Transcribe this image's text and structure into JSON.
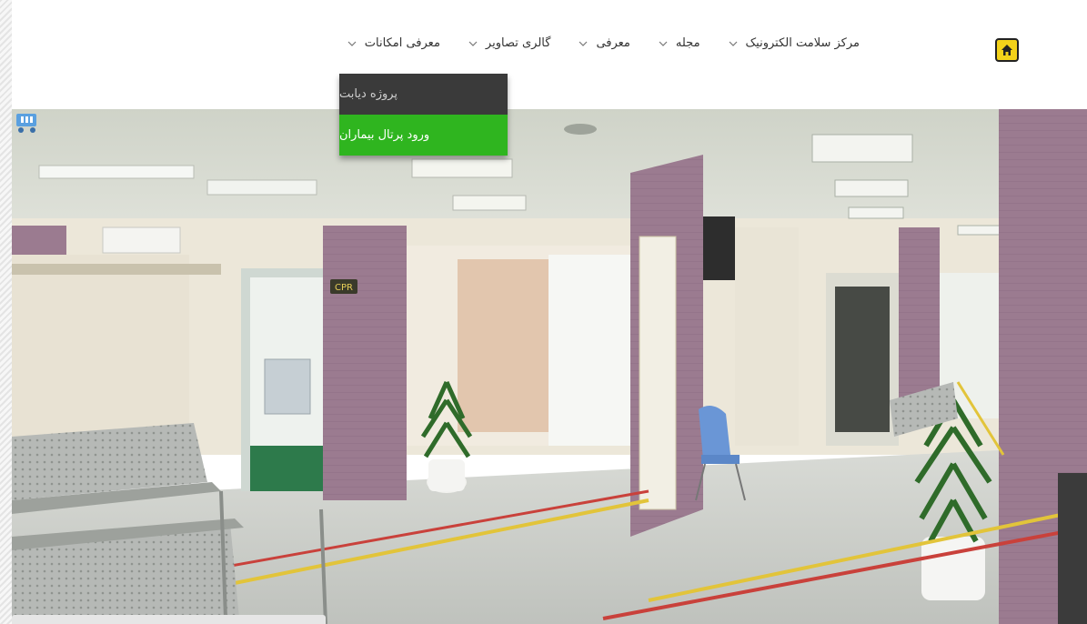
{
  "nav": {
    "items": [
      {
        "label": "معرفی امکانات"
      },
      {
        "label": "گالری تصاویر"
      },
      {
        "label": "معرفی"
      },
      {
        "label": "مجله"
      },
      {
        "label": "مرکز سلامت الکترونیک"
      }
    ]
  },
  "dropdown": {
    "items": [
      {
        "label": "پروژه دیابت"
      },
      {
        "label": "ورود پرتال بیماران"
      }
    ]
  },
  "hero": {
    "sign_text": "CPR"
  },
  "colors": {
    "home_button": "#f3d21a",
    "dropdown_active": "#2fb51f",
    "dropdown_dark": "#3a3a3a",
    "wall_purple": "#9d7d92"
  }
}
